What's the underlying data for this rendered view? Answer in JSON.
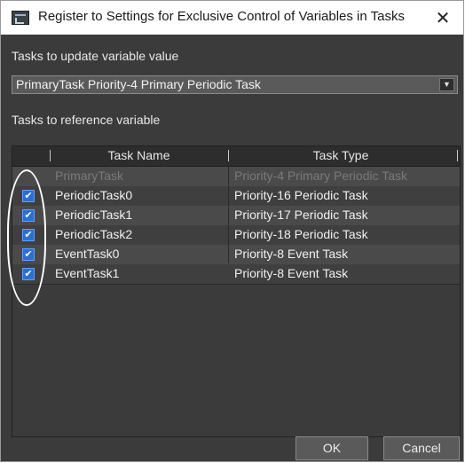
{
  "window": {
    "title": "Register to Settings for Exclusive Control of Variables in Tasks",
    "close_glyph": "✕"
  },
  "update_section": {
    "label": "Tasks to update variable value",
    "selected": "PrimaryTask Priority-4 Primary Periodic Task",
    "arrow_glyph": "▼"
  },
  "reference_section": {
    "label": "Tasks to reference variable"
  },
  "table": {
    "columns": [
      "Task Name",
      "Task Type"
    ],
    "rows": [
      {
        "name": "PrimaryTask",
        "type": "Priority-4 Primary Periodic Task",
        "checked": false,
        "disabled": true
      },
      {
        "name": "PeriodicTask0",
        "type": "Priority-16 Periodic Task",
        "checked": true,
        "disabled": false
      },
      {
        "name": "PeriodicTask1",
        "type": "Priority-17 Periodic Task",
        "checked": true,
        "disabled": false
      },
      {
        "name": "PeriodicTask2",
        "type": "Priority-18 Periodic Task",
        "checked": true,
        "disabled": false
      },
      {
        "name": "EventTask0",
        "type": "Priority-8 Event Task",
        "checked": true,
        "disabled": false
      },
      {
        "name": "EventTask1",
        "type": "Priority-8 Event Task",
        "checked": true,
        "disabled": false
      }
    ],
    "check_glyph": "✔"
  },
  "buttons": {
    "ok": "OK",
    "cancel": "Cancel"
  },
  "colors": {
    "background": "#3b3b3b",
    "checkbox": "#2b6fd1",
    "highlight_oval": "#ffffff"
  }
}
